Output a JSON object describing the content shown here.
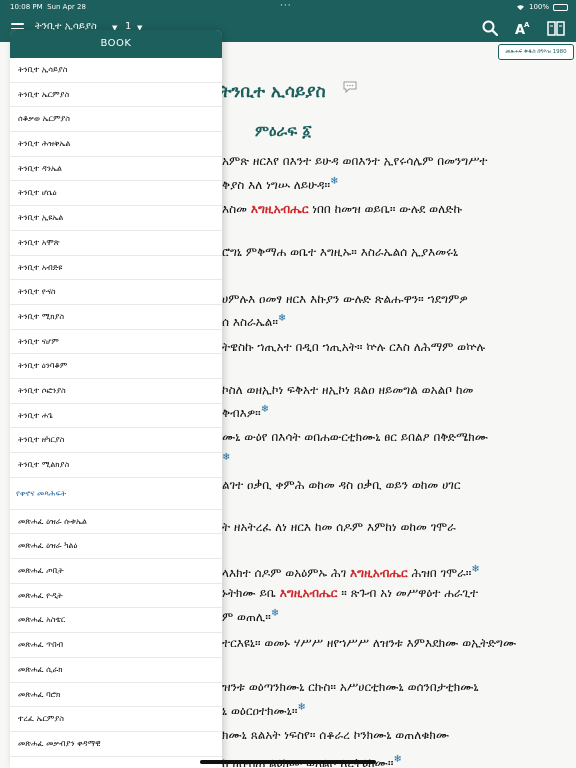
{
  "status_bar": {
    "time": "10:08 PM",
    "date": "Sun Apr 28",
    "battery": "100%",
    "battery_level": 100
  },
  "nav": {
    "book_title": "ትንቢተ ኢሳይያስ",
    "chapter": "1",
    "icons": [
      "hamburger-menu-icon",
      "search-icon",
      "font-size-icon",
      "book-icon"
    ]
  },
  "colors": {
    "primary": "#1d5f5c",
    "highlight": "#d0262b",
    "link": "#2a6ea8",
    "verse_marker": "#1d6fa5"
  },
  "reader": {
    "year_badge": "መጽሐፍ ቅዱስ በግእዝ 1980",
    "book_heading": "ትንቢተ ኢሳይያስ",
    "chapter_heading": "ምዕራፍ ፩",
    "lines": [
      {
        "pre": "አምጽ ዘርእየ በእንተ ይሁዳ ወበእንተ ኢየሩሳሌም በመንግሥተ",
        "hl": "",
        "post": "",
        "star": false
      },
      {
        "pre": "ቅያስ እለ ነግሡ ለይሁዳ።",
        "hl": "",
        "post": "",
        "star": true
      },
      {
        "pre": "እስመ ",
        "hl": "እግዚአብሔር",
        "post": " ነበበ ከመዝ ወይቤ። ውሉደ ወለድኩ",
        "star": false
      },
      {
        "pre": "ሮግኒ ምቅማሐ ወቤተ እግዚኡ። እስራኤልሰ ኢያእመሩኒ",
        "hl": "",
        "post": "",
        "star": false
      },
      {
        "pre": "ሀምሉእ ዐመፃ ዘርእ እኩያን ውሉድ ጽልሑዋን። ኀደግምዎ",
        "hl": "",
        "post": "",
        "star": false
      },
      {
        "pre": "ሰ እስራኤል።",
        "hl": "",
        "post": "",
        "star": true
      },
      {
        "pre": "ትዌስኩ ኀጢአተ በዲበ ኀጢአት። ኵሉ ርእስ ለሕማም ወኵሉ",
        "hl": "",
        "post": "",
        "star": false
      },
      {
        "pre": "ኮስለ ወዘኢኮነ ፍቅአተ ዘኢኮነ ጸልዐ ዘይመግል ወአልቦ ከመ",
        "hl": "",
        "post": "",
        "star": false
      },
      {
        "pre": "ቅብእዎ።",
        "hl": "",
        "post": "",
        "star": true
      },
      {
        "pre": "ሙኒ ውዕየ በእሳት ወበሐውርቲክሙኒ ፀር ይበልዖ በቅድሜክሙ",
        "hl": "",
        "post": "",
        "star": false
      },
      {
        "pre": "",
        "hl": "",
        "post": "",
        "star": true
      },
      {
        "pre": "ልገተ ዐቃቢ ቀምሕ ወከመ ዳስ ዐቃቢ ወይን ወከመ ሀገር",
        "hl": "",
        "post": "",
        "star": false
      },
      {
        "pre": "ት ዘአትረፈ ለነ ዘርእ ከመ ሰዶም እምከነ ወከመ ገሞራ",
        "hl": "",
        "post": "",
        "star": false
      },
      {
        "pre": "ላእክተ ሰዶም ወአዕምኡ ሕገ ",
        "hl": "እግዚአብሔር",
        "post": " ሕዝበ ገሞራ።",
        "star": true
      },
      {
        "pre": "ኑትክሙ ይቤ ",
        "hl": "እግዚአብሔር",
        "post": " ። ጽጉብ አነ መሥዋዕተ ሐራጊተ",
        "star": false
      },
      {
        "pre": "ም ወጠሊ።",
        "hl": "",
        "post": "",
        "star": true
      },
      {
        "pre": "ተርእዩኒ። ወመኑ ሃሥሥ ዘየኀሥሥ ለዝንቱ እምእደክሙ ወኢትድግሙ",
        "hl": "",
        "post": "",
        "star": false
      },
      {
        "pre": "ዝንቱ ወዕጣንክሙኒ ርኩስ። አሥሀርቲክሙኒ ወሰንበታቲክሙኒ",
        "hl": "",
        "post": "",
        "star": false
      },
      {
        "pre": "ኒ ወዕርዐተክሙኒ።",
        "hl": "",
        "post": "",
        "star": true
      },
      {
        "pre": "ክሙኒ ጸልአት ነፍስየ። ሰቆራረ ኮንክሙኒ ወጠለቁክሙ",
        "hl": "",
        "post": "",
        "star": false
      },
      {
        "pre": "ከ ዘስብሐ ልዕክሙ ወአልቦ ለረትዕክሙ።",
        "hl": "",
        "post": "",
        "star": true
      }
    ]
  },
  "drawer": {
    "header": "BOOK",
    "items": [
      "ትንቢተ ኢሳይያስ",
      "ትንቢተ ኤርምያስ",
      "ሰቆቃወ ኤርምያስ",
      "ትንቢተ ሕዝቅኤል",
      "ትንቢተ ዳንኤል",
      "ትንቢተ ሆሴዕ",
      "ትንቢተ ኢዩኤል",
      "ትንቢተ አሞጽ",
      "ትንቢተ አብድዩ",
      "ትንቢተ ዮናስ",
      "ትንቢተ ሚክያስ",
      "ትንቢተ ናሆም",
      "ትንቢተ ዕንባቆም",
      "ትንቢተ ሶፎንያስ",
      "ትንቢተ ሐጌ",
      "ትንቢተ ዘካርያስ",
      "ትንቢተ ሚልክያስ"
    ],
    "section_label": "የቀኖና መጻሕፍት",
    "items2": [
      "መጽሐፈ ዕዝራ ሱቱኤል",
      "መጽሐፈ ዕዝራ ካልዕ",
      "መጽሐፈ ጦቢት",
      "መጽሐፈ ዮዲት",
      "መጽሐፈ አስቴር",
      "መጽሐፈ ጥበብ",
      "መጽሐፈ ሲራክ",
      "መጽሐፈ ባሮክ",
      "ተረፈ ኤርምያስ",
      "መጽሐፈ መቃብያን ቀዳማዊ"
    ]
  }
}
